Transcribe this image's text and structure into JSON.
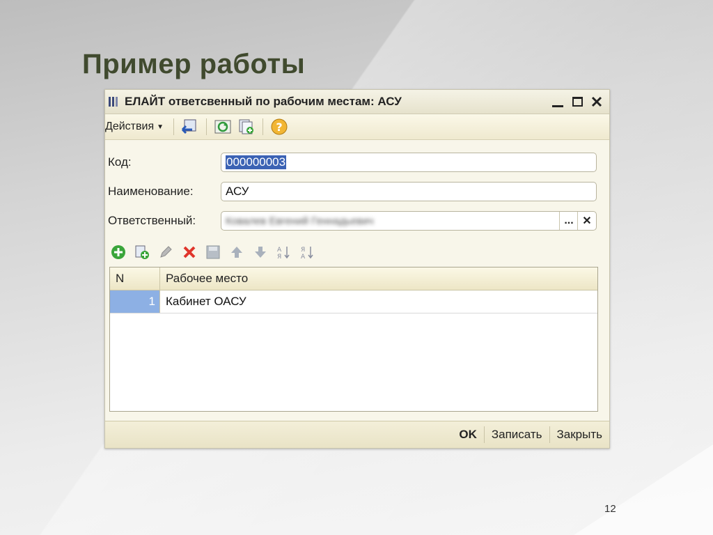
{
  "slide": {
    "title": "Пример работы",
    "page_number": "12"
  },
  "window": {
    "title": "ЕЛАЙТ ответсвенный по рабочим местам: АСУ"
  },
  "toolbar": {
    "actions_label": "Действия"
  },
  "form": {
    "code_label": "Код:",
    "code_value": "000000003",
    "name_label": "Наименование:",
    "name_value": "АСУ",
    "responsible_label": "Ответственный:",
    "responsible_value": "Ковалев Евгений Геннадьевич",
    "select_button": "...",
    "clear_button": "✕"
  },
  "table": {
    "columns": [
      "N",
      "Рабочее место"
    ],
    "rows": [
      {
        "n": "1",
        "workplace": "Кабинет ОАСУ"
      }
    ]
  },
  "footer": {
    "ok_label": "OK",
    "save_label": "Записать",
    "close_label": "Закрыть"
  },
  "colors": {
    "title": "#404a2e",
    "selection": "#3b62b4",
    "row_number_bg": "#8db0e4",
    "delete_icon": "#e0352b",
    "add_icon": "#3aa53a"
  }
}
